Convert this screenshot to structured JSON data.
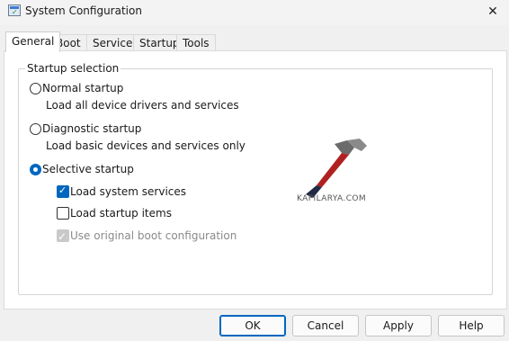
{
  "window": {
    "title": "System Configuration"
  },
  "tabs": [
    "General",
    "Boot",
    "Services",
    "Startup",
    "Tools"
  ],
  "startup_selection": {
    "legend": "Startup selection",
    "normal": {
      "label": "Normal startup",
      "description": "Load all device drivers and services"
    },
    "diagnostic": {
      "label": "Diagnostic startup",
      "description": "Load basic devices and services only"
    },
    "selective": {
      "label": "Selective startup",
      "options": [
        {
          "label": "Load system services",
          "checked": true
        },
        {
          "label": "Load startup items",
          "checked": false
        },
        {
          "label": "Use original boot configuration",
          "checked": true,
          "disabled": true
        }
      ]
    },
    "selected": "selective"
  },
  "watermark": {
    "text": "KAPILARYA.COM"
  },
  "buttons": {
    "ok": "OK",
    "cancel": "Cancel",
    "apply": "Apply",
    "help": "Help"
  },
  "colors": {
    "accent": "#0067c0"
  }
}
